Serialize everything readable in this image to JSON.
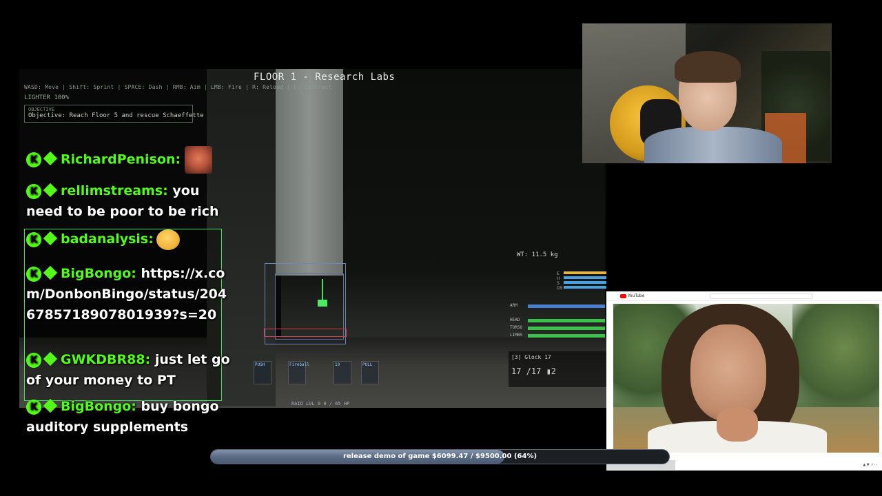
{
  "game": {
    "floor_title": "FLOOR 1 - Research Labs",
    "controls_hint": "WASD: Move | Shift: Sprint | SPACE: Dash | RMB: Aim | LMB: Fire | R: Reload | F: Interact",
    "lighter": "LIGHTER 100%",
    "objective_header": "OBJECTIVE",
    "objective_text": "Objective: Reach Floor 5 and rescue Schaeffette",
    "weight": "WT: 11.5 kg",
    "status_bars": [
      {
        "label": "E",
        "color": "#e3b64a",
        "fill": 1.0
      },
      {
        "label": "H",
        "color": "#4aa0e3",
        "fill": 1.0
      },
      {
        "label": "S",
        "color": "#4aa0e3",
        "fill": 1.0
      },
      {
        "label": "DS",
        "color": "#4aa0e3",
        "fill": 1.0
      }
    ],
    "body_parts": [
      {
        "label": "ARM",
        "color": "#4a7fd0",
        "value": "100/100",
        "fill": 1.0
      },
      {
        "label": "HEAD",
        "color": "#3cc14a",
        "value": "100",
        "fill": 1.0
      },
      {
        "label": "TORSO",
        "color": "#3cc14a",
        "value": "100",
        "fill": 1.0
      },
      {
        "label": "LIMBS",
        "color": "#3cc14a",
        "value": "100",
        "fill": 1.0
      }
    ],
    "clock_label": "[3]  Glock 17",
    "ammo": "17 /17  ▮2",
    "hotbar": [
      "PUSH",
      "Fireball",
      "10",
      "PULL"
    ],
    "raid_status": "RAID LVL 0   0 / 65 HP"
  },
  "chat": [
    {
      "user": "RichardPenison:",
      "text": "",
      "emote": "face"
    },
    {
      "user": "rellimstreams:",
      "text": "you need to be poor to be rich",
      "emote": ""
    },
    {
      "user": "badanalysis:",
      "text": "",
      "emote": "duck"
    },
    {
      "user": "BigBongo:",
      "text": "https://x.com/DonbonBingo/status/2046785718907801939?s=20",
      "emote": ""
    },
    {
      "user": "GWKDBR88:",
      "text": "just let go of your money to PT",
      "emote": ""
    },
    {
      "user": "BigBongo:",
      "text": "buy bongo auditory supplements",
      "emote": ""
    }
  ],
  "youtube": {
    "logo_text": "YouTube",
    "search_placeholder": "Search"
  },
  "goal": {
    "label": "release demo of game $6099.47 / $9500.00 (64%)",
    "progress": 0.64,
    "fill_color": "#5a6b84"
  }
}
